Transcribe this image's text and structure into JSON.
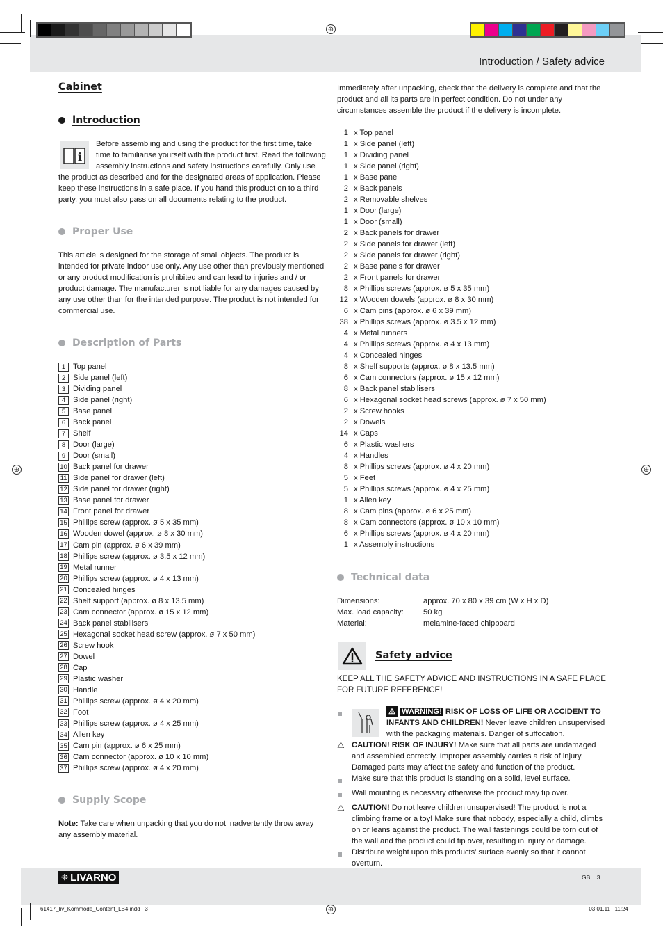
{
  "header": {
    "title": "Introduction / Safety advice",
    "gray_swatches": [
      "#000000",
      "#1a1a1a",
      "#333333",
      "#4d4d4d",
      "#666666",
      "#808080",
      "#999999",
      "#b3b3b3",
      "#cccccc",
      "#e6e6e6",
      "#ffffff"
    ],
    "color_swatches": [
      "#fff200",
      "#ec008c",
      "#00aeef",
      "#2e3192",
      "#00a651",
      "#ed1c24",
      "#231f20",
      "#fff799",
      "#f49ac1",
      "#6dcff6",
      "#939598"
    ]
  },
  "left": {
    "title": "Cabinet",
    "intro": {
      "heading": "Introduction",
      "text_indented": "Before assembling and using the product for the first time, take time to familiarise yourself with the product first. Read the following assembly instructions and safety instructions carefully. Only use",
      "text_rest": "the product as described and for the designated areas of application. Please keep these instructions in a safe place. If you hand this product on to a third party, you must also pass on all documents relating to the product."
    },
    "proper_use": {
      "heading": "Proper Use",
      "text": "This article is designed for the storage of small objects. The product is intended for private indoor use only. Any use other than previously mentioned or any product modification is prohibited and can lead to injuries and / or product damage. The manufacturer is not liable for any damages caused by any use other than for the intended purpose. The product is not intended for commercial use."
    },
    "parts": {
      "heading": "Description of Parts",
      "items": [
        {
          "n": "1",
          "label": "Top panel"
        },
        {
          "n": "2",
          "label": "Side panel (left)"
        },
        {
          "n": "3",
          "label": "Dividing panel"
        },
        {
          "n": "4",
          "label": "Side panel (right)"
        },
        {
          "n": "5",
          "label": "Base panel"
        },
        {
          "n": "6",
          "label": "Back panel"
        },
        {
          "n": "7",
          "label": "Shelf"
        },
        {
          "n": "8",
          "label": "Door (large)"
        },
        {
          "n": "9",
          "label": "Door (small)"
        },
        {
          "n": "10",
          "label": "Back panel for drawer"
        },
        {
          "n": "11",
          "label": "Side panel for drawer (left)"
        },
        {
          "n": "12",
          "label": "Side panel for drawer (right)"
        },
        {
          "n": "13",
          "label": "Base panel for drawer"
        },
        {
          "n": "14",
          "label": "Front panel for drawer"
        },
        {
          "n": "15",
          "label": "Phillips screw (approx. ø 5 x 35 mm)"
        },
        {
          "n": "16",
          "label": "Wooden dowel (approx. ø 8 x 30 mm)"
        },
        {
          "n": "17",
          "label": "Cam pin (approx. ø 6 x 39 mm)"
        },
        {
          "n": "18",
          "label": "Phillips screw (approx. ø 3.5 x 12 mm)"
        },
        {
          "n": "19",
          "label": "Metal runner"
        },
        {
          "n": "20",
          "label": "Phillips screw (approx. ø 4 x 13 mm)"
        },
        {
          "n": "21",
          "label": "Concealed hinges"
        },
        {
          "n": "22",
          "label": "Shelf support (approx. ø 8 x 13.5 mm)"
        },
        {
          "n": "23",
          "label": "Cam connector (approx. ø 15 x 12 mm)"
        },
        {
          "n": "24",
          "label": "Back panel stabilisers"
        },
        {
          "n": "25",
          "label": "Hexagonal socket head screw (approx. ø 7 x 50 mm)"
        },
        {
          "n": "26",
          "label": "Screw hook"
        },
        {
          "n": "27",
          "label": "Dowel"
        },
        {
          "n": "28",
          "label": "Cap"
        },
        {
          "n": "29",
          "label": "Plastic washer"
        },
        {
          "n": "30",
          "label": "Handle"
        },
        {
          "n": "31",
          "label": "Phillips screw (approx. ø 4 x 20 mm)"
        },
        {
          "n": "32",
          "label": "Foot"
        },
        {
          "n": "33",
          "label": "Phillips screw (approx. ø 4 x 25 mm)"
        },
        {
          "n": "34",
          "label": "Allen key"
        },
        {
          "n": "35",
          "label": "Cam pin (approx. ø 6 x 25 mm)"
        },
        {
          "n": "36",
          "label": "Cam connector (approx. ø 10 x 10 mm)"
        },
        {
          "n": "37",
          "label": "Phillips screw (approx. ø 4 x 20 mm)"
        }
      ]
    },
    "supply": {
      "heading": "Supply Scope",
      "note_label": "Note:",
      "note_text": " Take care when unpacking that you do not inadvertently throw away any assembly material."
    }
  },
  "right": {
    "unpack_text": "Immediately after unpacking, check that the delivery is complete and that the product and all its parts are in perfect condition. Do not under any circumstances assemble the product if the delivery is incomplete.",
    "supply_items": [
      {
        "q": "1",
        "label": "x Top panel"
      },
      {
        "q": "1",
        "label": "x Side panel (left)"
      },
      {
        "q": "1",
        "label": "x Dividing panel"
      },
      {
        "q": "1",
        "label": "x Side panel (right)"
      },
      {
        "q": "1",
        "label": "x Base panel"
      },
      {
        "q": "2",
        "label": "x Back panels"
      },
      {
        "q": "2",
        "label": "x Removable shelves"
      },
      {
        "q": "1",
        "label": "x Door (large)"
      },
      {
        "q": "1",
        "label": "x Door (small)"
      },
      {
        "q": "2",
        "label": "x Back panels for drawer"
      },
      {
        "q": "2",
        "label": "x Side panels for drawer (left)"
      },
      {
        "q": "2",
        "label": "x Side panels for drawer (right)"
      },
      {
        "q": "2",
        "label": "x Base panels for drawer"
      },
      {
        "q": "2",
        "label": "x Front panels for drawer"
      },
      {
        "q": "8",
        "label": "x Phillips screws (approx. ø 5 x 35 mm)"
      },
      {
        "q": "12",
        "label": "x Wooden dowels (approx. ø 8 x 30 mm)"
      },
      {
        "q": "6",
        "label": "x Cam pins (approx. ø 6 x 39 mm)"
      },
      {
        "q": "38",
        "label": "x Phillips screws (approx. ø 3.5 x 12 mm)"
      },
      {
        "q": "4",
        "label": "x Metal runners"
      },
      {
        "q": "4",
        "label": "x Phillips screws (approx. ø 4 x 13 mm)"
      },
      {
        "q": "4",
        "label": "x Concealed hinges"
      },
      {
        "q": "8",
        "label": "x Shelf supports (approx. ø 8 x 13.5 mm)"
      },
      {
        "q": "6",
        "label": "x Cam connectors (approx. ø 15 x 12 mm)"
      },
      {
        "q": "8",
        "label": "x Back panel stabilisers"
      },
      {
        "q": "6",
        "label": "x Hexagonal socket head screws (approx. ø 7 x 50 mm)"
      },
      {
        "q": "2",
        "label": "x Screw hooks"
      },
      {
        "q": "2",
        "label": "x Dowels"
      },
      {
        "q": "14",
        "label": "x Caps"
      },
      {
        "q": "6",
        "label": "x Plastic washers"
      },
      {
        "q": "4",
        "label": "x Handles"
      },
      {
        "q": "8",
        "label": "x Phillips screws (approx. ø 4 x 20 mm)"
      },
      {
        "q": "5",
        "label": "x Feet"
      },
      {
        "q": "5",
        "label": "x Phillips screws (approx. ø 4 x 25 mm)"
      },
      {
        "q": "1",
        "label": "x Allen key"
      },
      {
        "q": "8",
        "label": "x Cam pins (approx. ø 6 x 25 mm)"
      },
      {
        "q": "8",
        "label": "x Cam connectors (approx. ø 10 x 10 mm)"
      },
      {
        "q": "6",
        "label": "x Phillips screws (approx. ø 4 x 20 mm)"
      },
      {
        "q": "1",
        "label": "x Assembly instructions"
      }
    ],
    "technical": {
      "heading": "Technical data",
      "rows": [
        {
          "k": "Dimensions:",
          "v": "approx. 70 x 80 x 39 cm (W x H x D)"
        },
        {
          "k": "Max. load capacity:",
          "v": "50 kg"
        },
        {
          "k": "Material:",
          "v": "melamine-faced chipboard"
        }
      ]
    },
    "safety": {
      "heading": "Safety advice",
      "keep": "KEEP ALL THE SAFETY ADVICE AND INSTRUCTIONS IN A SAFE PLACE FOR FUTURE REFERENCE!",
      "warning_label": "WARNING!",
      "warning_bold": " RISK OF LOSS OF LIFE OR ACCIDENT TO INFANTS AND CHILDREN!",
      "warning_text": " Never leave children unsupervised with the packaging materials. Danger of suffocation.",
      "caution1_bold": "CAUTION! RISK OF INJURY!",
      "caution1_text": " Make sure that all parts are undamaged and assembled correctly. Improper assembly carries a risk of injury. Damaged parts may affect the safety and function of the product.",
      "bullet1": "Make sure that this product is standing on a solid, level surface.",
      "bullet2": "Wall mounting is necessary otherwise the product may tip over.",
      "caution2_bold": "CAUTION!",
      "caution2_text": " Do not leave children unsupervised! The product is not a climbing frame or a toy! Make sure that nobody, especially a child, climbs on or leans against the product. The wall fastenings could be torn out of the wall and the product could tip over, resulting in injury or damage.",
      "bullet3": "Distribute weight upon this products’ surface evenly so that it cannot overturn."
    }
  },
  "footer": {
    "brand": "LIVARNO",
    "lang": "GB",
    "page": "3",
    "file": "61417_liv_Kommode_Content_LB4.indd   3",
    "date": "03.01.11   11:24"
  }
}
